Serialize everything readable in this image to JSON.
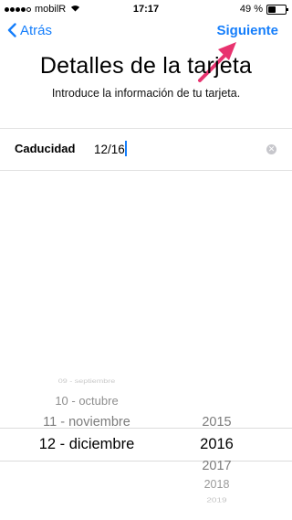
{
  "status_bar": {
    "carrier": "mobilR",
    "time": "17:17",
    "battery_text": "49 %",
    "battery_level": 0.49,
    "signal_bars_filled": 4,
    "signal_bars_total": 5
  },
  "nav": {
    "back_label": "Atrás",
    "next_label": "Siguiente"
  },
  "header": {
    "title": "Detalles de la tarjeta",
    "subtitle": "Introduce la información de tu tarjeta."
  },
  "form": {
    "expiry_label": "Caducidad",
    "expiry_value": "12/16"
  },
  "picker": {
    "months": [
      "09 - septiembre",
      "10 - octubre",
      "11 - noviembre",
      "12 - diciembre"
    ],
    "selected_month": "12 - diciembre",
    "years_above": [
      "2015"
    ],
    "selected_year": "2016",
    "years_below": [
      "2017",
      "2018",
      "2019"
    ]
  },
  "colors": {
    "accent": "#157efb",
    "annotation_arrow": "#e8336f"
  }
}
